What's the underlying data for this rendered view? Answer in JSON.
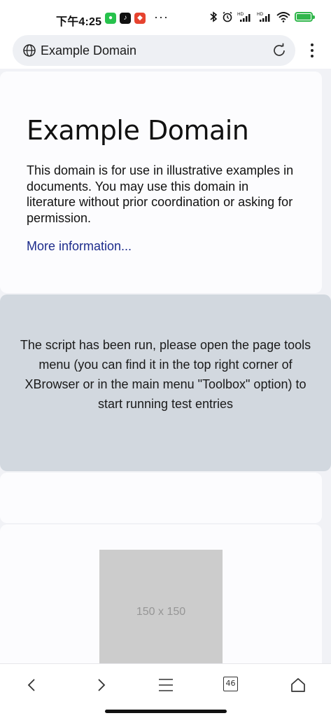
{
  "status_bar": {
    "time": "下午4:25",
    "more": "···",
    "battery_percent": 100
  },
  "address_bar": {
    "title": "Example Domain"
  },
  "page": {
    "heading": "Example Domain",
    "description": "This domain is for use in illustrative examples in documents. You may use this domain in literature without prior coordination or asking for permission.",
    "link_text": "More information..."
  },
  "notice": {
    "text": "The script has been run, please open the page tools menu (you can find it in the top right corner of XBrowser or in the main menu \"Toolbox\" option) to start running test entries"
  },
  "placeholder": {
    "label": "150 x 150"
  },
  "bottom_nav": {
    "tab_count": "46"
  },
  "colors": {
    "link": "#1d2c8c",
    "notice_background": "#d2d8df",
    "battery": "#30b64b"
  }
}
